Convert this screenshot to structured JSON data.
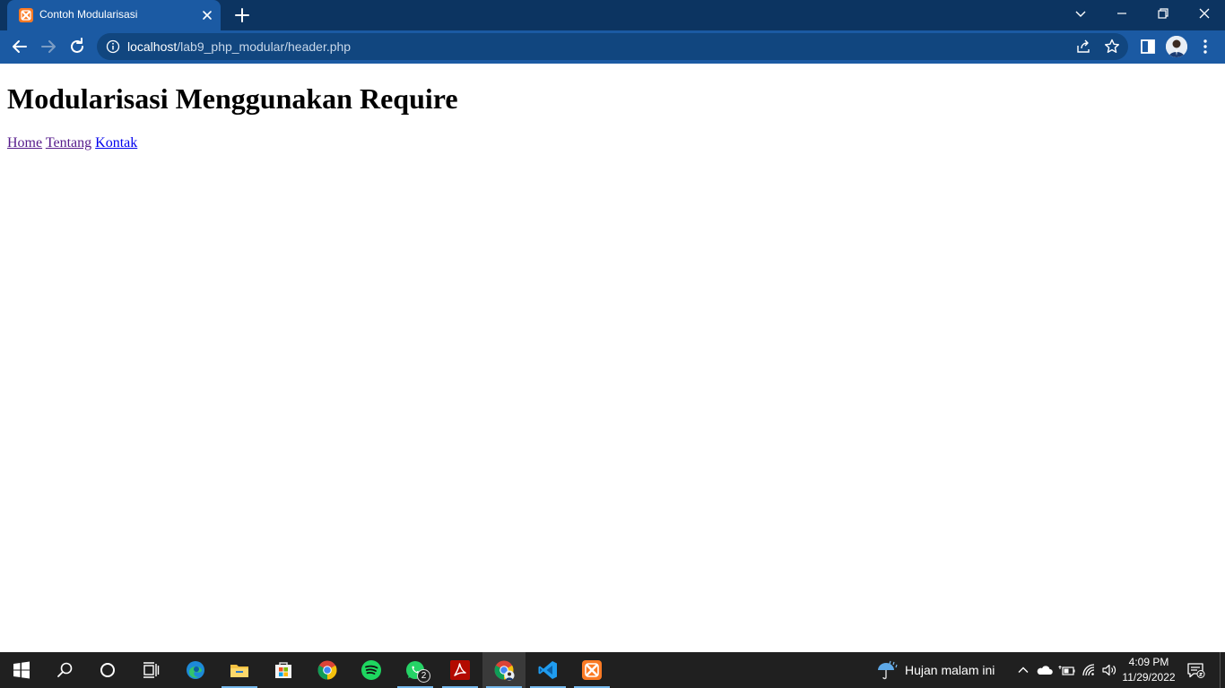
{
  "browser": {
    "tab": {
      "title": "Contoh Modularisasi",
      "favicon": "xampp-icon"
    },
    "url": {
      "host": "localhost",
      "path": "/lab9_php_modular/header.php"
    }
  },
  "page": {
    "heading": "Modularisasi Menggunakan Require",
    "nav": [
      {
        "label": "Home",
        "state": "visited"
      },
      {
        "label": "Tentang",
        "state": "visited"
      },
      {
        "label": "Kontak",
        "state": "unvisited"
      }
    ]
  },
  "taskbar": {
    "apps": [
      "start-icon",
      "search-icon",
      "cortana-icon",
      "task-view-icon",
      "edge-icon",
      "file-explorer-icon",
      "store-icon",
      "chrome-icon",
      "spotify-icon",
      "whatsapp-icon",
      "acrobat-icon",
      "chrome-profile-icon",
      "vscode-icon",
      "xampp-icon"
    ],
    "whatsapp_badge": "2",
    "weather": "Hujan malam ini",
    "time": "4:09 PM",
    "date": "11/29/2022"
  },
  "colors": {
    "tabstrip": "#0c3461",
    "toolbar": "#1b5aa3",
    "omnibox": "#11467f",
    "taskbar": "#202020",
    "link_visited": "#551a8b",
    "link_unvisited": "#0000ee"
  }
}
